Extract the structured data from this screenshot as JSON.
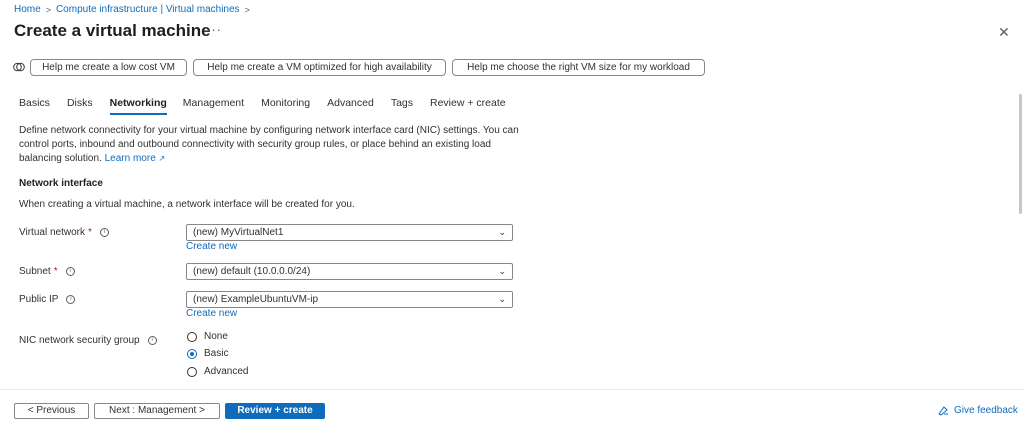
{
  "breadcrumb": {
    "items": [
      "Home",
      "Compute infrastructure | Virtual machines"
    ],
    "separator": ">"
  },
  "header": {
    "title": "Create a virtual machine",
    "more_label": "···",
    "close_label": "✕"
  },
  "copilot": {
    "icon": "copilot-icon",
    "chips": [
      "Help me create a low cost VM",
      "Help me create a VM optimized for high availability",
      "Help me choose the right VM size for my workload"
    ]
  },
  "tabs": [
    "Basics",
    "Disks",
    "Networking",
    "Management",
    "Monitoring",
    "Advanced",
    "Tags",
    "Review + create"
  ],
  "active_tab": "Networking",
  "description": {
    "text": "Define network connectivity for your virtual machine by configuring network interface card (NIC) settings. You can control ports, inbound and outbound connectivity with security group rules, or place behind an existing load balancing solution.",
    "learn_more": "Learn more",
    "learn_more_icon": "external-link-icon"
  },
  "network_interface": {
    "heading": "Network interface",
    "note": "When creating a virtual machine, a network interface will be created for you.",
    "virtual_network": {
      "label": "Virtual network",
      "required": "*",
      "value": "(new) MyVirtualNet1",
      "create_new": "Create new"
    },
    "subnet": {
      "label": "Subnet",
      "required": "*",
      "value": "(new) default (10.0.0.0/24)"
    },
    "public_ip": {
      "label": "Public IP",
      "value": "(new) ExampleUbuntuVM-ip",
      "create_new": "Create new"
    },
    "nsg": {
      "label": "NIC network security group",
      "options": [
        "None",
        "Basic",
        "Advanced"
      ],
      "selected": "Basic"
    }
  },
  "footer": {
    "previous": "< Previous",
    "next": "Next : Management >",
    "review": "Review + create",
    "feedback": "Give feedback"
  },
  "colors": {
    "accent": "#0f6cbd",
    "required": "#a4262c",
    "text": "#323130",
    "border": "#8a8886"
  }
}
